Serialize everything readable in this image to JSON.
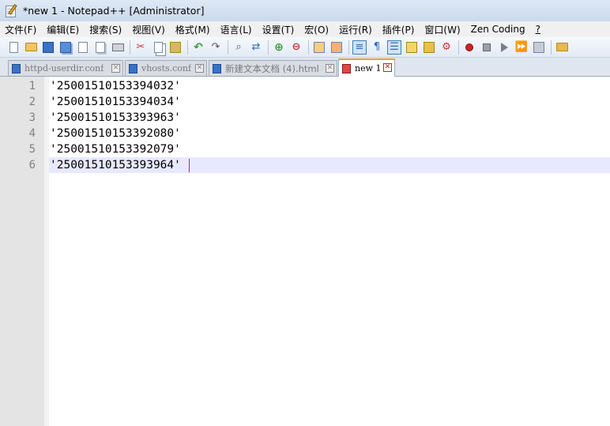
{
  "window": {
    "title": "*new 1 - Notepad++ [Administrator]"
  },
  "menu": [
    "文件(F)",
    "编辑(E)",
    "搜索(S)",
    "视图(V)",
    "格式(M)",
    "语言(L)",
    "设置(T)",
    "宏(O)",
    "运行(R)",
    "插件(P)",
    "窗口(W)",
    "Zen Coding",
    "?"
  ],
  "toolbar": {
    "icons": [
      "new-file-icon",
      "open-folder-icon",
      "save-icon",
      "save-all-icon",
      "close-icon",
      "close-all-icon",
      "print-icon",
      "cut-icon",
      "copy-icon",
      "paste-icon",
      "undo-icon",
      "redo-icon",
      "find-icon",
      "replace-icon",
      "zoom-in-icon",
      "zoom-out-icon",
      "sync-v-icon",
      "sync-h-icon",
      "word-wrap-icon",
      "show-all-chars-icon",
      "indent-guide-icon",
      "user-lang-icon",
      "doc-map-icon",
      "function-list-icon",
      "record-macro-icon",
      "stop-macro-icon",
      "play-macro-icon",
      "run-macro-multiple-icon",
      "save-macro-icon",
      "folder-as-workspace-icon"
    ]
  },
  "tabs": [
    {
      "label": "httpd-userdir.conf",
      "active": false,
      "icon_color": "#3a72c8"
    },
    {
      "label": "vhosts.conf",
      "active": false,
      "icon_color": "#3a72c8"
    },
    {
      "label": "新建文本文档 (4).html",
      "active": false,
      "icon_color": "#3a72c8"
    },
    {
      "label": "new 1",
      "active": true,
      "icon_color": "#e04848"
    }
  ],
  "editor": {
    "current_line": 6,
    "lines": [
      {
        "n": "1",
        "text": "'25001510153394032'"
      },
      {
        "n": "2",
        "text": "'25001510153394034'"
      },
      {
        "n": "3",
        "text": "'25001510153393963'"
      },
      {
        "n": "4",
        "text": "'25001510153392080'"
      },
      {
        "n": "5",
        "text": "'25001510153392079'"
      },
      {
        "n": "6",
        "text": "'25001510153393964'"
      }
    ]
  },
  "colors": {
    "current_line_bg": "#e8e8ff",
    "gutter_bg": "#e4e4e4",
    "active_tab_accent": "#f0a030",
    "caret": "#8a2be2"
  }
}
